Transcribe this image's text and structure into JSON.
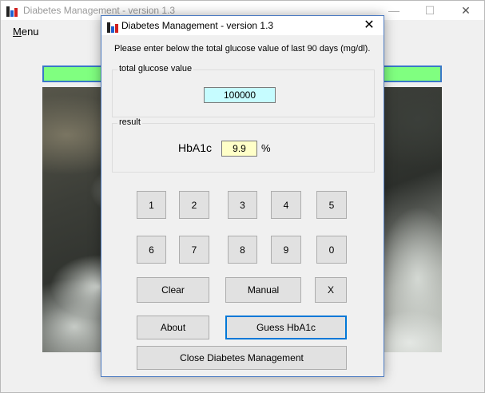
{
  "main_window": {
    "title": "Diabetes Management - version 1.3",
    "menu": {
      "label": "Menu",
      "accel": "M",
      "rest": "enu"
    },
    "controls": {
      "minimize": "—",
      "maximize": "☐",
      "close": "✕"
    }
  },
  "dialog": {
    "title": "Diabetes Management - version 1.3",
    "close": "✕",
    "instruction": "Please enter below the total glucose value of last 90 days (mg/dl).",
    "glucose_group": {
      "label": "total glucose value",
      "value": "100000"
    },
    "result_group": {
      "label": "result",
      "hba1c_label": "HbA1c",
      "hba1c_value": "9.9",
      "unit": "%"
    },
    "keypad": [
      "1",
      "2",
      "3",
      "4",
      "5",
      "6",
      "7",
      "8",
      "9",
      "0"
    ],
    "buttons": {
      "clear": "Clear",
      "manual": "Manual",
      "x": "X",
      "about": "About",
      "guess": "Guess HbA1c",
      "close_app": "Close Diabetes Management"
    }
  }
}
